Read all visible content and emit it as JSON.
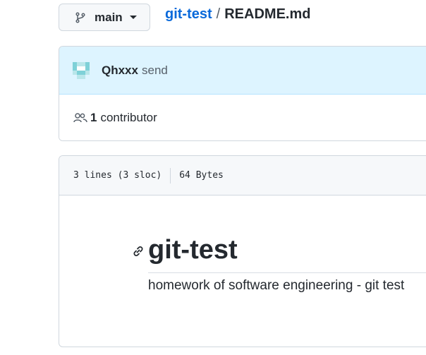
{
  "branch": {
    "icon": "git-branch-icon",
    "name": "main",
    "caret_icon": "triangle-down-icon"
  },
  "breadcrumb": {
    "repo": "git-test",
    "separator": "/",
    "file": "README.md"
  },
  "commit": {
    "avatar_icon": "identicon-avatar",
    "author": "Qhxxx",
    "message": "send",
    "header_bg": "#ddf4ff"
  },
  "contributors": {
    "icon": "people-icon",
    "count": "1",
    "label": "contributor"
  },
  "file_info": {
    "lines": "3 lines (3 sloc)",
    "size": "64 Bytes"
  },
  "readme": {
    "anchor_icon": "link-icon",
    "heading": "git-test",
    "paragraph": "homework of software engineering - git test"
  },
  "colors": {
    "link": "#0969da",
    "text": "#24292f",
    "muted": "#57606a",
    "border": "#d0d7de"
  }
}
